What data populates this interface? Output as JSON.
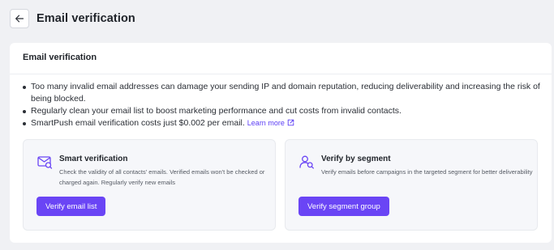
{
  "header": {
    "title": "Email verification",
    "back_icon": "arrow-left-icon"
  },
  "card": {
    "title": "Email verification",
    "bullets": [
      "Too many invalid email addresses can damage your sending IP and domain reputation, reducing deliverability and increasing the risk of being blocked.",
      "Regularly clean your email list to boost marketing performance and cut costs from invalid contacts.",
      "SmartPush email verification costs just $0.002 per email."
    ],
    "learn_more": "Learn more",
    "learn_more_icon": "external-link-icon",
    "accent_color": "#6a45f5"
  },
  "options": [
    {
      "icon": "email-search-icon",
      "title": "Smart verification",
      "description": "Check the validity of all contacts' emails. Verified emails won't be checked or charged again. Regularly verify new emails",
      "button": "Verify email list"
    },
    {
      "icon": "users-search-icon",
      "title": "Verify by segment",
      "description": "Verify emails before campaigns in the targeted segment for better deliverability",
      "button": "Verify segment group"
    }
  ]
}
